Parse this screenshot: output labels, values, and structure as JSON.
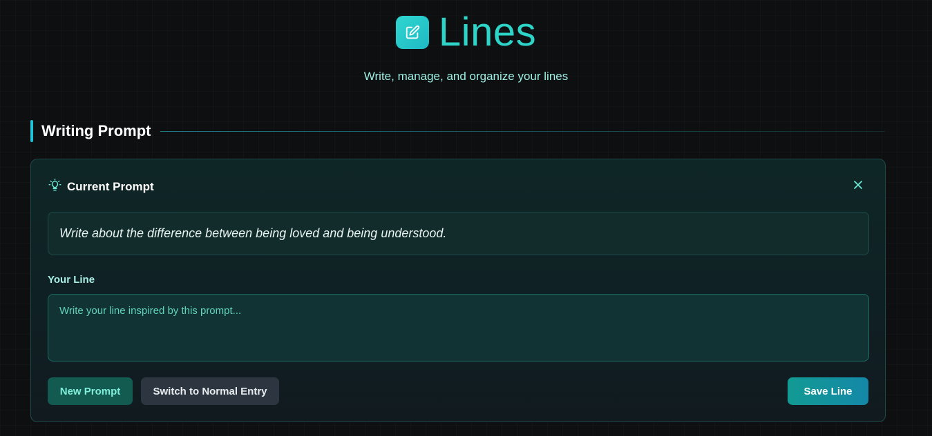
{
  "header": {
    "app_title": "Lines",
    "subtitle": "Write, manage, and organize your lines",
    "logo_icon": "edit-icon"
  },
  "section": {
    "title": "Writing Prompt"
  },
  "prompt_card": {
    "title": "Current Prompt",
    "title_icon": "lightbulb-icon",
    "close_icon": "close-icon",
    "prompt_text": "Write about the difference between being loved and being understood.",
    "field_label": "Your Line",
    "input_value": "",
    "input_placeholder": "Write your line inspired by this prompt...",
    "buttons": {
      "new_prompt": "New Prompt",
      "switch_entry": "Switch to Normal Entry",
      "save_line": "Save Line"
    }
  },
  "colors": {
    "accent": "#2dd4c8",
    "background": "#0e0f11",
    "card_bg": "#0f2626",
    "save_gradient_start": "#129a93",
    "save_gradient_end": "#1488a8"
  }
}
